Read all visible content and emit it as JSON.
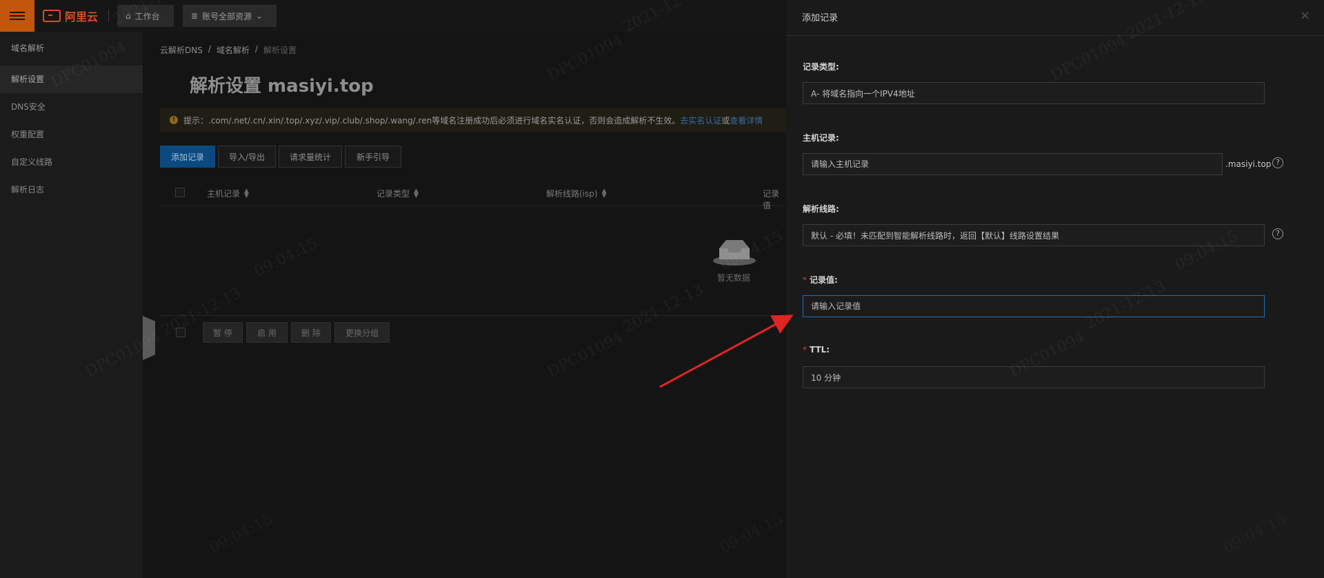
{
  "topbar": {
    "brand": "阿里云",
    "workspace_label": "工作台",
    "resources_label": "账号全部资源"
  },
  "sidebar": {
    "items": [
      {
        "label": "域名解析"
      },
      {
        "label": "解析设置"
      },
      {
        "label": "DNS安全"
      },
      {
        "label": "权重配置"
      },
      {
        "label": "自定义线路"
      },
      {
        "label": "解析日志"
      }
    ]
  },
  "breadcrumb": [
    "云解析DNS",
    "域名解析",
    "解析设置"
  ],
  "page_title": "解析设置 masiyi.top",
  "notice": {
    "prefix": "提示：.com/.net/.cn/.xin/.top/.xyz/.vip/.club/.shop/.wang/.ren等域名注册成功后必须进行域名实名认证，否则会造成解析不生效。",
    "link1": "去实名认证",
    "joiner": "或",
    "link2": "查看详情"
  },
  "toolbar": {
    "add": "添加记录",
    "import_export": "导入/导出",
    "stats": "请求量统计",
    "guide": "新手引导"
  },
  "table": {
    "columns": [
      "主机记录",
      "记录类型",
      "解析线路(isp)",
      "记录值"
    ],
    "empty_text": "暂无数据",
    "footer_buttons": [
      "暂 停",
      "启 用",
      "删 除",
      "更换分组"
    ]
  },
  "drawer": {
    "title": "添加记录",
    "close": "×",
    "fields": {
      "record_type": {
        "label": "记录类型:",
        "value": "A- 将域名指向一个IPV4地址"
      },
      "host": {
        "label": "主机记录:",
        "placeholder": "请输入主机记录",
        "suffix": ".masiyi.top"
      },
      "line": {
        "label": "解析线路:",
        "value": "默认 - 必填！未匹配到智能解析线路时，返回【默认】线路设置结果"
      },
      "record_value": {
        "label": "记录值:",
        "placeholder": "请输入记录值"
      },
      "ttl": {
        "label": "TTL:",
        "value": "10 分钟"
      }
    },
    "help_glyph": "?"
  },
  "watermark": {
    "id": "DPC01094",
    "date": "2021-12-13",
    "time": "09:04:15"
  },
  "colors": {
    "accent": "#0a4a80",
    "focus_border": "#1c6fc4",
    "required": "#e03a3a",
    "annotation_arrow": "#e02424"
  }
}
